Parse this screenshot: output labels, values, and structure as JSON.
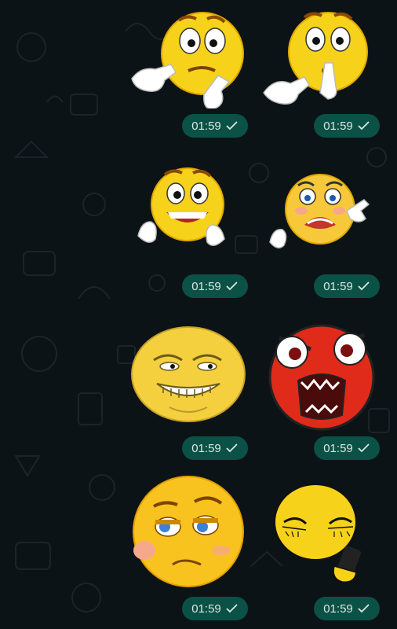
{
  "messages": [
    {
      "id": "m1",
      "sticker": "thinking-emoji-sticker",
      "time": "01:59"
    },
    {
      "id": "m2",
      "sticker": "shushing-emoji-sticker",
      "time": "01:59"
    },
    {
      "id": "m3",
      "sticker": "grinning-emoji-sticker",
      "time": "01:59"
    },
    {
      "id": "m4",
      "sticker": "annoyed-pointing-emoji-sticker",
      "time": "01:59"
    },
    {
      "id": "m5",
      "sticker": "trollface-emoji-sticker",
      "time": "01:59"
    },
    {
      "id": "m6",
      "sticker": "rage-emoji-sticker",
      "time": "01:59"
    },
    {
      "id": "m7",
      "sticker": "smug-emoji-sticker",
      "time": "01:59"
    },
    {
      "id": "m8",
      "sticker": "squinting-phone-emoji-sticker",
      "time": "01:59"
    }
  ],
  "icons": {
    "status": "single-check-icon"
  },
  "colors": {
    "background": "#0c1317",
    "bubble": "#0b5146",
    "bubble_text": "#d9e7e3",
    "sticker_yellow": "#f7d21a",
    "sticker_red": "#e02a1a"
  }
}
